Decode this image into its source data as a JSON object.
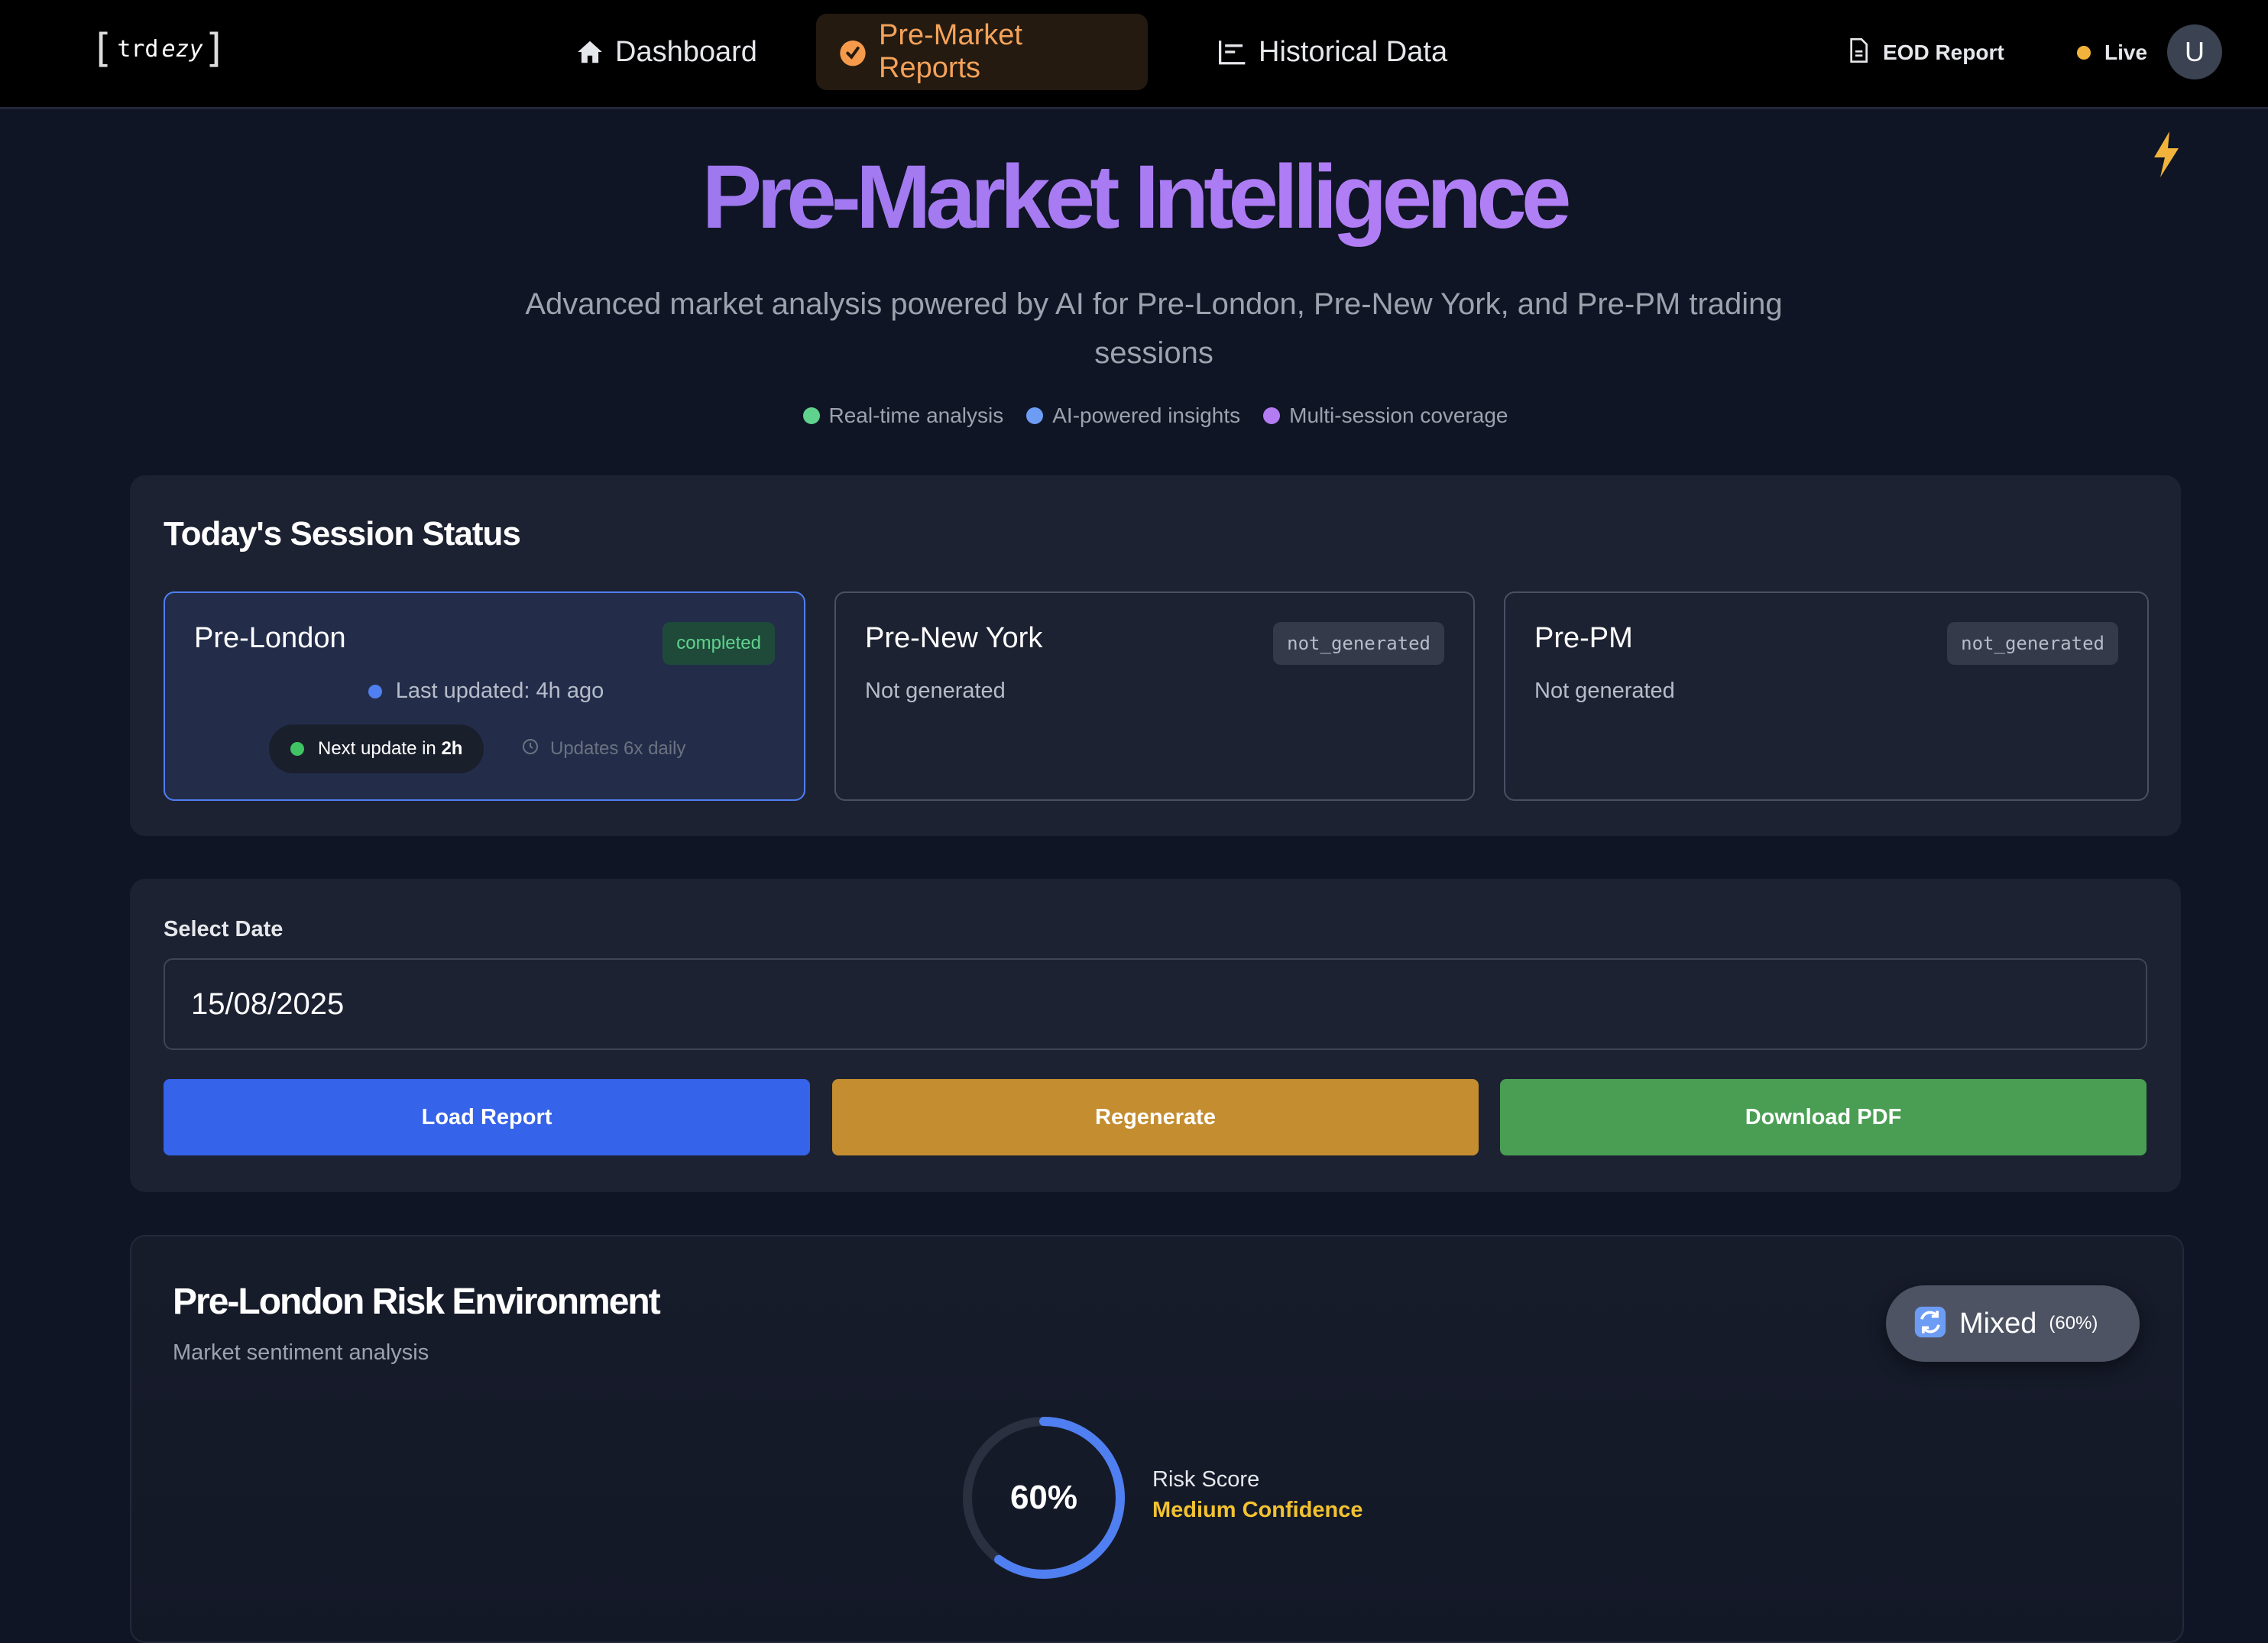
{
  "nav": {
    "logo_main": "trd",
    "logo_accent": "ezy",
    "items": [
      {
        "label": "Dashboard",
        "icon": "home-icon"
      },
      {
        "label": "Pre-Market Reports",
        "icon": "clock-badge-icon",
        "active": true
      },
      {
        "label": "Historical Data",
        "icon": "chart-icon"
      }
    ],
    "eod_label": "EOD Report",
    "live_label": "Live",
    "avatar_initial": "U"
  },
  "hero": {
    "title": "Pre-Market Intelligence",
    "subtitle": "Advanced market analysis powered by AI for Pre-London, Pre-New York, and Pre-PM trading sessions",
    "features": [
      {
        "label": "Real-time analysis",
        "color": "#5fd38d"
      },
      {
        "label": "AI-powered insights",
        "color": "#6d9cf5"
      },
      {
        "label": "Multi-session coverage",
        "color": "#b47cf2"
      }
    ]
  },
  "session_status": {
    "title": "Today's Session Status",
    "cards": [
      {
        "name": "Pre-London",
        "status": "completed",
        "last_updated": "Last updated: 4h ago",
        "next_update_prefix": "Next update in",
        "next_update_value": "2h",
        "updates_info": "Updates 6x daily"
      },
      {
        "name": "Pre-New York",
        "status": "not_generated",
        "text": "Not generated"
      },
      {
        "name": "Pre-PM",
        "status": "not_generated",
        "text": "Not generated"
      }
    ]
  },
  "date_panel": {
    "label": "Select Date",
    "value": "15/08/2025",
    "buttons": {
      "load": "Load Report",
      "regenerate": "Regenerate",
      "download": "Download PDF"
    }
  },
  "risk": {
    "title": "Pre-London Risk Environment",
    "subtitle": "Market sentiment analysis",
    "sentiment_label": "Mixed",
    "sentiment_pct": "(60%)",
    "score_text": "60%",
    "score_value": 60,
    "score_label": "Risk Score",
    "confidence": "Medium Confidence"
  }
}
